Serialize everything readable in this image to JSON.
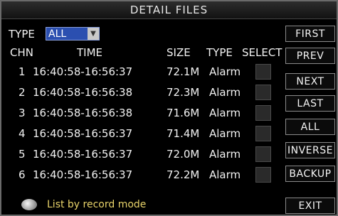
{
  "title": "DETAIL FILES",
  "filter": {
    "label": "TYPE",
    "selected": "ALL"
  },
  "columns": {
    "chn": "CHN",
    "time": "TIME",
    "size": "SIZE",
    "type": "TYPE",
    "select": "SELECT"
  },
  "rows": [
    {
      "chn": "1",
      "time": "16:40:58-16:56:37",
      "size": "72.1M",
      "type": "Alarm"
    },
    {
      "chn": "2",
      "time": "16:40:58-16:56:38",
      "size": "72.3M",
      "type": "Alarm"
    },
    {
      "chn": "3",
      "time": "16:40:58-16:56:38",
      "size": "71.6M",
      "type": "Alarm"
    },
    {
      "chn": "4",
      "time": "16:40:58-16:56:37",
      "size": "71.4M",
      "type": "Alarm"
    },
    {
      "chn": "5",
      "time": "16:40:58-16:56:37",
      "size": "72.0M",
      "type": "Alarm"
    },
    {
      "chn": "6",
      "time": "16:40:58-16:56:37",
      "size": "72.2M",
      "type": "Alarm"
    }
  ],
  "buttons": {
    "first": "FIRST",
    "prev": "PREV",
    "next": "NEXT",
    "last": "LAST",
    "all": "ALL",
    "inverse": "INVERSE",
    "backup": "BACKUP",
    "exit": "EXIT"
  },
  "status": {
    "icon": "speech-bubble-icon",
    "text": "List by record mode"
  },
  "colors": {
    "select_bg": "#2b4fb0",
    "status_text": "#e8d36a",
    "background": "#000000"
  }
}
